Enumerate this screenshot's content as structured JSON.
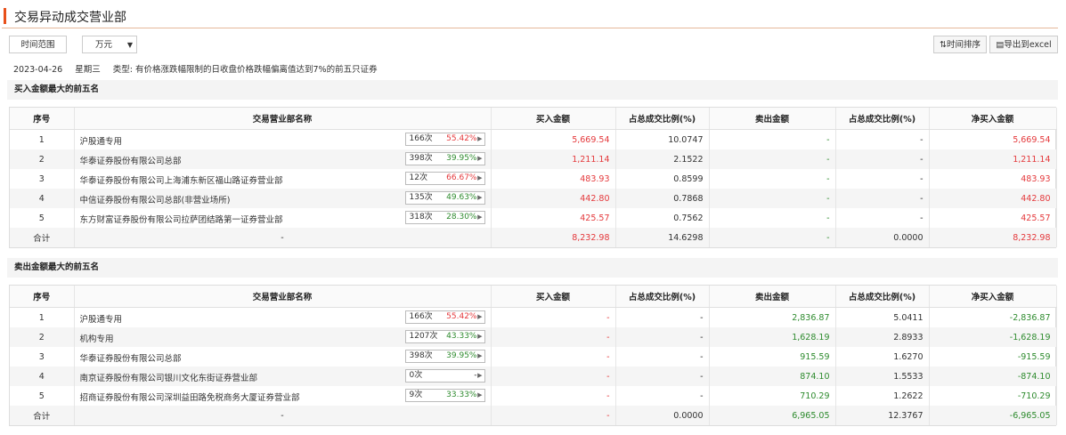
{
  "header": {
    "title": "交易异动成交营业部"
  },
  "toolbar": {
    "range_btn": "时间范围",
    "unit_select": "万元",
    "sort_btn": "时间排序",
    "export_btn": "导出到excel"
  },
  "info": {
    "date": "2023-04-26",
    "weekday": "星期三",
    "type_label": "类型:",
    "type_text": "有价格涨跌幅限制的日收盘价格跌幅偏离值达到7%的前五只证券"
  },
  "columns": [
    "序号",
    "交易营业部名称",
    "买入金额",
    "占总成交比例(%)",
    "卖出金额",
    "占总成交比例(%)",
    "净买入金额"
  ],
  "buy_section": {
    "title": "买入金额最大的前五名",
    "rows": [
      {
        "no": "1",
        "name": "沪股通专用",
        "count": "166次",
        "pct": "55.42%",
        "pct_color": "red",
        "buy": "5,669.54",
        "buy_ratio": "10.0747",
        "sell": "-",
        "sell_ratio": "-",
        "net": "5,669.54"
      },
      {
        "no": "2",
        "name": "华泰证券股份有限公司总部",
        "count": "398次",
        "pct": "39.95%",
        "pct_color": "green",
        "buy": "1,211.14",
        "buy_ratio": "2.1522",
        "sell": "-",
        "sell_ratio": "-",
        "net": "1,211.14"
      },
      {
        "no": "3",
        "name": "华泰证券股份有限公司上海浦东新区福山路证券营业部",
        "count": "12次",
        "pct": "66.67%",
        "pct_color": "red",
        "buy": "483.93",
        "buy_ratio": "0.8599",
        "sell": "-",
        "sell_ratio": "-",
        "net": "483.93"
      },
      {
        "no": "4",
        "name": "中信证券股份有限公司总部(非营业场所)",
        "count": "135次",
        "pct": "49.63%",
        "pct_color": "green",
        "buy": "442.80",
        "buy_ratio": "0.7868",
        "sell": "-",
        "sell_ratio": "-",
        "net": "442.80"
      },
      {
        "no": "5",
        "name": "东方财富证券股份有限公司拉萨团结路第一证券营业部",
        "count": "318次",
        "pct": "28.30%",
        "pct_color": "green",
        "buy": "425.57",
        "buy_ratio": "0.7562",
        "sell": "-",
        "sell_ratio": "-",
        "net": "425.57"
      }
    ],
    "total": {
      "label": "合计",
      "name": "-",
      "buy": "8,232.98",
      "buy_ratio": "14.6298",
      "sell": "-",
      "sell_ratio": "0.0000",
      "net": "8,232.98"
    }
  },
  "sell_section": {
    "title": "卖出金额最大的前五名",
    "rows": [
      {
        "no": "1",
        "name": "沪股通专用",
        "count": "166次",
        "pct": "55.42%",
        "pct_color": "red",
        "buy": "-",
        "buy_ratio": "-",
        "sell": "2,836.87",
        "sell_ratio": "5.0411",
        "net": "-2,836.87"
      },
      {
        "no": "2",
        "name": "机构专用",
        "count": "1207次",
        "pct": "43.33%",
        "pct_color": "green",
        "buy": "-",
        "buy_ratio": "-",
        "sell": "1,628.19",
        "sell_ratio": "2.8933",
        "net": "-1,628.19"
      },
      {
        "no": "3",
        "name": "华泰证券股份有限公司总部",
        "count": "398次",
        "pct": "39.95%",
        "pct_color": "green",
        "buy": "-",
        "buy_ratio": "-",
        "sell": "915.59",
        "sell_ratio": "1.6270",
        "net": "-915.59"
      },
      {
        "no": "4",
        "name": "南京证券股份有限公司银川文化东街证券营业部",
        "count": "0次",
        "pct": "-",
        "pct_color": "",
        "buy": "-",
        "buy_ratio": "-",
        "sell": "874.10",
        "sell_ratio": "1.5533",
        "net": "-874.10"
      },
      {
        "no": "5",
        "name": "招商证券股份有限公司深圳益田路免税商务大厦证券营业部",
        "count": "9次",
        "pct": "33.33%",
        "pct_color": "green",
        "buy": "-",
        "buy_ratio": "-",
        "sell": "710.29",
        "sell_ratio": "1.2622",
        "net": "-710.29"
      }
    ],
    "total": {
      "label": "合计",
      "name": "-",
      "buy": "-",
      "buy_ratio": "0.0000",
      "sell": "6,965.05",
      "sell_ratio": "12.3767",
      "net": "-6,965.05"
    }
  },
  "colors": {
    "accent": "#e8501a",
    "up": "#e4393c",
    "down": "#2e8b2e"
  }
}
